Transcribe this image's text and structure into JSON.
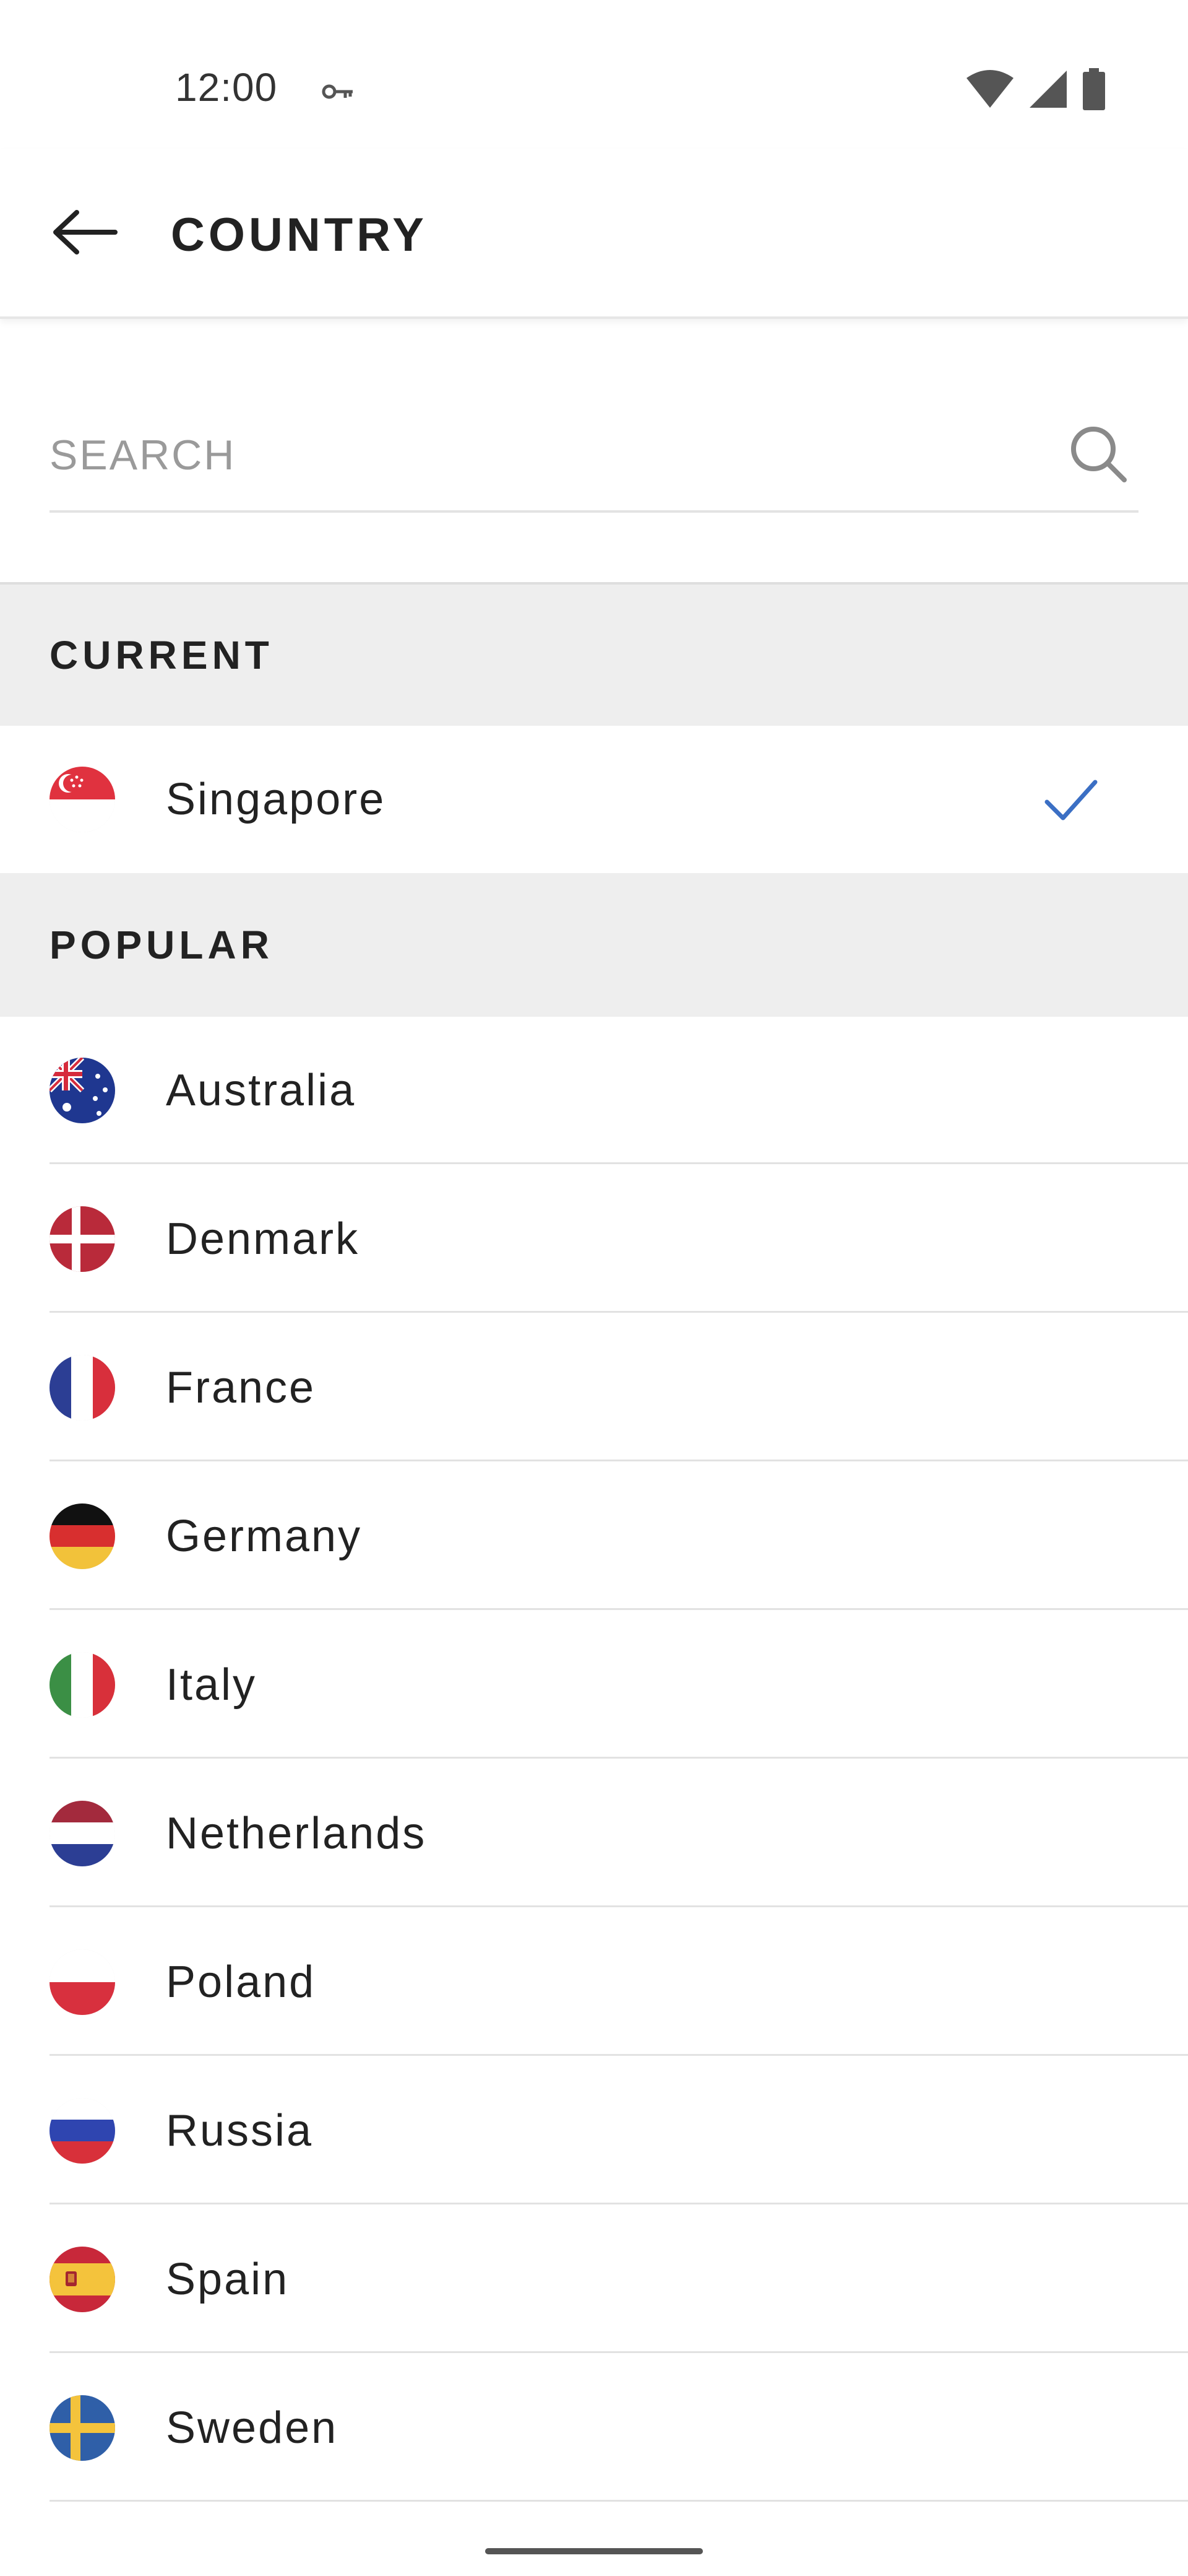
{
  "status_bar": {
    "time": "12:00",
    "icons": [
      "vpn-key-icon",
      "wifi-icon",
      "cell-signal-icon",
      "battery-icon"
    ]
  },
  "header": {
    "back_icon": "arrow-left-icon",
    "title": "COUNTRY"
  },
  "search": {
    "placeholder": "SEARCH",
    "value": "",
    "icon": "search-icon"
  },
  "sections": {
    "current": {
      "label": "CURRENT",
      "item": {
        "name": "Singapore",
        "flag": "singapore-flag-icon",
        "selected": true
      }
    },
    "popular": {
      "label": "POPULAR",
      "items": [
        {
          "name": "Australia",
          "flag": "australia-flag-icon"
        },
        {
          "name": "Denmark",
          "flag": "denmark-flag-icon"
        },
        {
          "name": "France",
          "flag": "france-flag-icon"
        },
        {
          "name": "Germany",
          "flag": "germany-flag-icon"
        },
        {
          "name": "Italy",
          "flag": "italy-flag-icon"
        },
        {
          "name": "Netherlands",
          "flag": "netherlands-flag-icon"
        },
        {
          "name": "Poland",
          "flag": "poland-flag-icon"
        },
        {
          "name": "Russia",
          "flag": "russia-flag-icon"
        },
        {
          "name": "Spain",
          "flag": "spain-flag-icon"
        },
        {
          "name": "Sweden",
          "flag": "sweden-flag-icon"
        }
      ]
    }
  },
  "colors": {
    "accent_check": "#3b6fc4",
    "section_bg": "#eeeeee",
    "divider": "#e2e2e2",
    "text": "#222222",
    "placeholder": "#9a9a9a"
  }
}
